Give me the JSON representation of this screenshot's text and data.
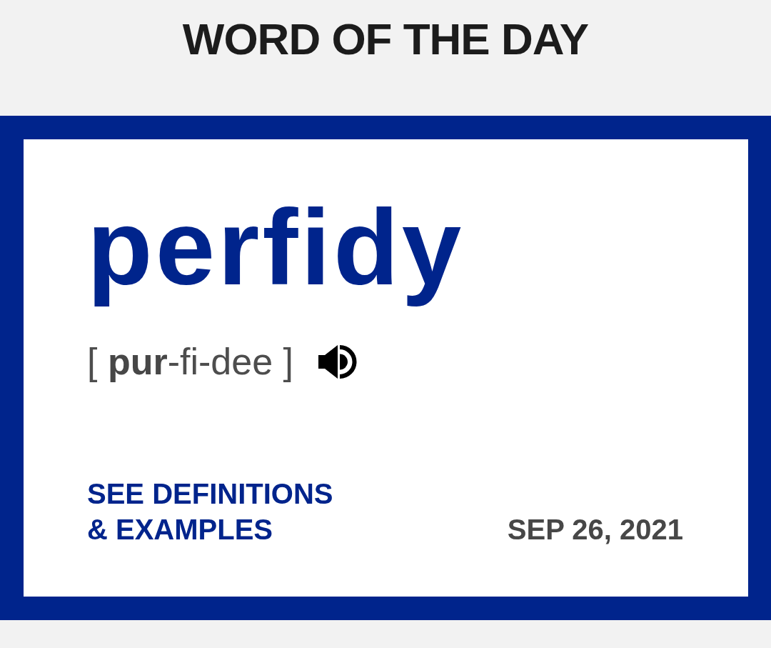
{
  "header": {
    "title": "WORD OF THE DAY"
  },
  "card": {
    "word": "perfidy",
    "pronunciation": "[ **pur**-fi-dee ]",
    "link": "SEE DEFINITIONS & EXAMPLES",
    "date": "SEP 26, 2021"
  }
}
